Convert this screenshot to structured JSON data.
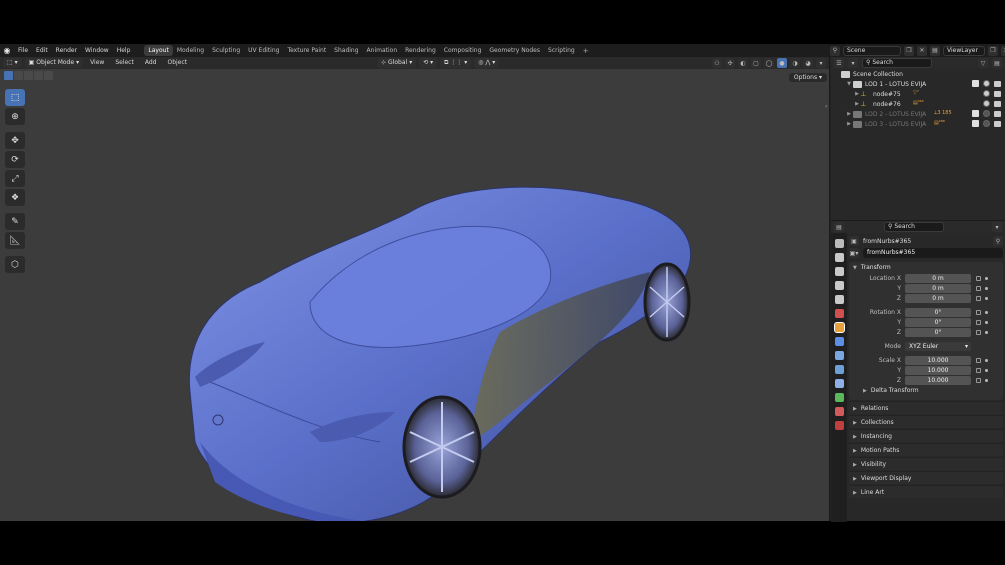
{
  "topbar": {
    "menus": [
      "File",
      "Edit",
      "Render",
      "Window",
      "Help"
    ],
    "workspace_tabs": [
      "Layout",
      "Modeling",
      "Sculpting",
      "UV Editing",
      "Texture Paint",
      "Shading",
      "Animation",
      "Rendering",
      "Compositing",
      "Geometry Nodes",
      "Scripting"
    ],
    "active_tab": "Layout",
    "add_tab": "+",
    "scene": "Scene",
    "view_layer": "ViewLayer"
  },
  "viewport": {
    "mode": "Object Mode",
    "menus": [
      "View",
      "Select",
      "Add",
      "Object"
    ],
    "orientation": "Global",
    "options_label": "Options",
    "model_color": "#5a6fc9"
  },
  "outliner": {
    "search_placeholder": "Search",
    "root": "Scene Collection",
    "rows": [
      {
        "label": "LOD 1 - LOTUS EVIJA",
        "dim": false,
        "indent": 1
      },
      {
        "label": "node#75",
        "dim": false,
        "indent": 2,
        "badge": "⁷"
      },
      {
        "label": "node#76",
        "dim": false,
        "indent": 2,
        "badge": "³⁶⁵"
      },
      {
        "label": "LOD 2 - LOTUS EVIJA",
        "dim": true,
        "indent": 1,
        "badge": "3 185"
      },
      {
        "label": "LOD 3 - LOTUS EVIJA",
        "dim": true,
        "indent": 1,
        "badge": "²⁸⁸"
      }
    ]
  },
  "properties": {
    "search_placeholder": "Search",
    "object_name": "fromNurbs#365",
    "object_data_name": "fromNurbs#365",
    "transform_title": "Transform",
    "location": {
      "label_x": "Location X",
      "label_y": "Y",
      "label_z": "Z",
      "x": "0 m",
      "y": "0 m",
      "z": "0 m"
    },
    "rotation": {
      "label_x": "Rotation X",
      "label_y": "Y",
      "label_z": "Z",
      "x": "0°",
      "y": "0°",
      "z": "0°"
    },
    "mode": {
      "label": "Mode",
      "value": "XYZ Euler"
    },
    "scale": {
      "label_x": "Scale X",
      "label_y": "Y",
      "label_z": "Z",
      "x": "10.000",
      "y": "10.000",
      "z": "10.000"
    },
    "delta_transform": "Delta Transform",
    "sections": [
      "Relations",
      "Collections",
      "Instancing",
      "Motion Paths",
      "Visibility",
      "Viewport Display",
      "Line Art"
    ]
  }
}
